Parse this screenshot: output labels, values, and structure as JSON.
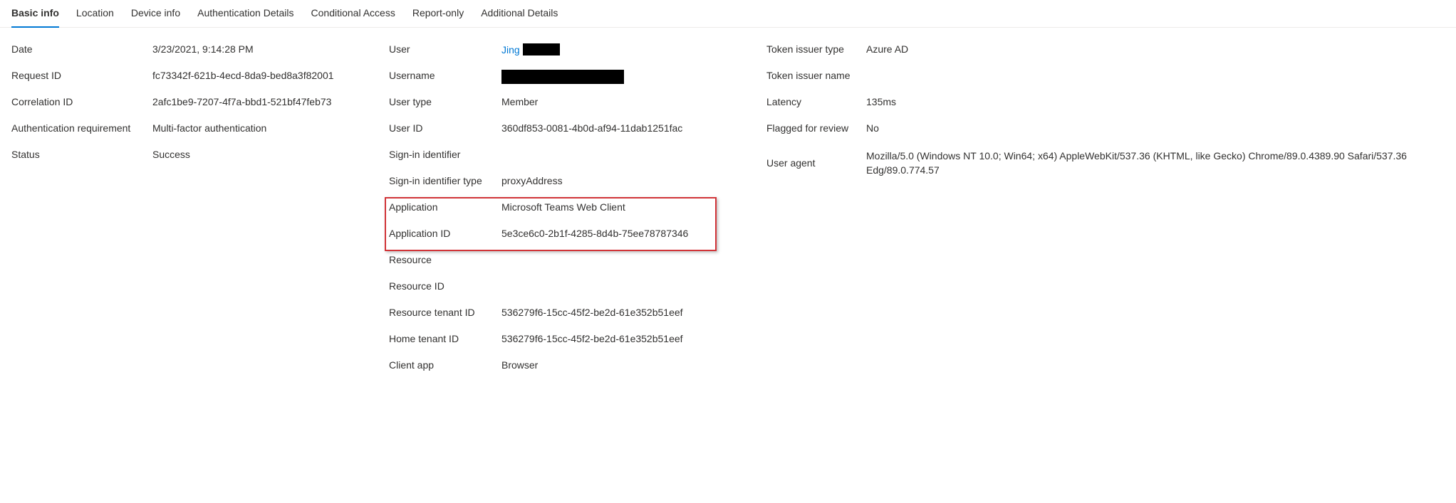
{
  "tabs": {
    "basic_info": "Basic info",
    "location": "Location",
    "device_info": "Device info",
    "authentication_details": "Authentication Details",
    "conditional_access": "Conditional Access",
    "report_only": "Report-only",
    "additional_details": "Additional Details"
  },
  "col1": {
    "date_label": "Date",
    "date_value": "3/23/2021, 9:14:28 PM",
    "request_id_label": "Request ID",
    "request_id_value": "fc73342f-621b-4ecd-8da9-bed8a3f82001",
    "correlation_id_label": "Correlation ID",
    "correlation_id_value": "2afc1be9-7207-4f7a-bbd1-521bf47feb73",
    "auth_req_label": "Authentication requirement",
    "auth_req_value": "Multi-factor authentication",
    "status_label": "Status",
    "status_value": "Success"
  },
  "col2": {
    "user_label": "User",
    "user_value": "Jing",
    "username_label": "Username",
    "user_type_label": "User type",
    "user_type_value": "Member",
    "user_id_label": "User ID",
    "user_id_value": "360df853-0081-4b0d-af94-11dab1251fac",
    "signin_identifier_label": "Sign-in identifier",
    "signin_identifier_type_label": "Sign-in identifier type",
    "signin_identifier_type_value": "proxyAddress",
    "application_label": "Application",
    "application_value": "Microsoft Teams Web Client",
    "application_id_label": "Application ID",
    "application_id_value": "5e3ce6c0-2b1f-4285-8d4b-75ee78787346",
    "resource_label": "Resource",
    "resource_id_label": "Resource ID",
    "resource_tenant_id_label": "Resource tenant ID",
    "resource_tenant_id_value": "536279f6-15cc-45f2-be2d-61e352b51eef",
    "home_tenant_id_label": "Home tenant ID",
    "home_tenant_id_value": "536279f6-15cc-45f2-be2d-61e352b51eef",
    "client_app_label": "Client app",
    "client_app_value": "Browser"
  },
  "col3": {
    "token_issuer_type_label": "Token issuer type",
    "token_issuer_type_value": "Azure AD",
    "token_issuer_name_label": "Token issuer name",
    "latency_label": "Latency",
    "latency_value": "135ms",
    "flagged_label": "Flagged for review",
    "flagged_value": "No",
    "user_agent_label": "User agent",
    "user_agent_value": "Mozilla/5.0 (Windows NT 10.0; Win64; x64) AppleWebKit/537.36 (KHTML, like Gecko) Chrome/89.0.4389.90 Safari/537.36 Edg/89.0.774.57"
  }
}
